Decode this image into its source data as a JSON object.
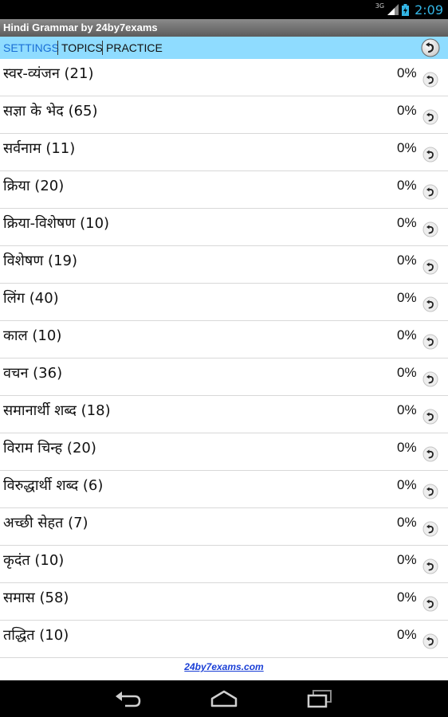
{
  "status_bar": {
    "network": "3G",
    "time": "2:09"
  },
  "app": {
    "title": "Hindi Grammar by 24by7exams"
  },
  "tabs": [
    {
      "label": "SETTINGS",
      "active": true
    },
    {
      "label": "TOPICS",
      "active": false
    },
    {
      "label": "PRACTICE",
      "active": false
    }
  ],
  "topics": [
    {
      "label": "स्वर-व्यंजन (21)",
      "progress": "0%"
    },
    {
      "label": "सज्ञा के भेद (65)",
      "progress": "0%"
    },
    {
      "label": "सर्वनाम (11)",
      "progress": "0%"
    },
    {
      "label": "क्रिया (20)",
      "progress": "0%"
    },
    {
      "label": "क्रिया-विशेषण (10)",
      "progress": "0%"
    },
    {
      "label": "विशेषण (19)",
      "progress": "0%"
    },
    {
      "label": "लिंग (40)",
      "progress": "0%"
    },
    {
      "label": "काल (10)",
      "progress": "0%"
    },
    {
      "label": "वचन (36)",
      "progress": "0%"
    },
    {
      "label": "समानार्थी शब्द (18)",
      "progress": "0%"
    },
    {
      "label": "विराम चिन्ह (20)",
      "progress": "0%"
    },
    {
      "label": "विरुद्धार्थी शब्द (6)",
      "progress": "0%"
    },
    {
      "label": "अच्छी सेहत (7)",
      "progress": "0%"
    },
    {
      "label": "कृदंत (10)",
      "progress": "0%"
    },
    {
      "label": "समास (58)",
      "progress": "0%"
    },
    {
      "label": "तद्धित (10)",
      "progress": "0%"
    }
  ],
  "footer": {
    "link": "24by7exams.com"
  },
  "colors": {
    "tab_bar": "#8fdcff",
    "active_tab": "#1a6fd6",
    "accent": "#33b5e5"
  }
}
